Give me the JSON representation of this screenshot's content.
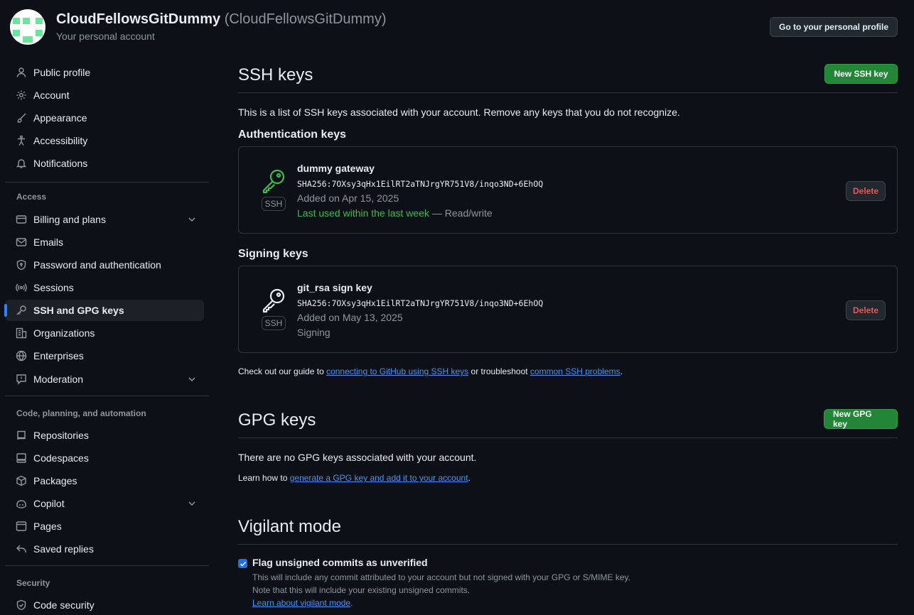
{
  "header": {
    "display_name": "CloudFellowsGitDummy",
    "login": "(CloudFellowsGitDummy)",
    "subtitle": "Your personal account",
    "profile_button": "Go to your personal profile"
  },
  "sidebar": {
    "group1": [
      {
        "label": "Public profile",
        "icon": "person-icon"
      },
      {
        "label": "Account",
        "icon": "gear-icon"
      },
      {
        "label": "Appearance",
        "icon": "paintbrush-icon"
      },
      {
        "label": "Accessibility",
        "icon": "accessibility-icon"
      },
      {
        "label": "Notifications",
        "icon": "bell-icon"
      }
    ],
    "access_heading": "Access",
    "access": [
      {
        "label": "Billing and plans",
        "icon": "credit-card-icon"
      },
      {
        "label": "Emails",
        "icon": "mail-icon"
      },
      {
        "label": "Password and authentication",
        "icon": "shield-lock-icon"
      },
      {
        "label": "Sessions",
        "icon": "broadcast-icon"
      },
      {
        "label": "SSH and GPG keys",
        "icon": "key-icon"
      },
      {
        "label": "Organizations",
        "icon": "organization-icon"
      },
      {
        "label": "Enterprises",
        "icon": "globe-icon"
      },
      {
        "label": "Moderation",
        "icon": "report-icon"
      }
    ],
    "code_heading": "Code, planning, and automation",
    "code": [
      {
        "label": "Repositories",
        "icon": "repo-icon"
      },
      {
        "label": "Codespaces",
        "icon": "codespaces-icon"
      },
      {
        "label": "Packages",
        "icon": "package-icon"
      },
      {
        "label": "Copilot",
        "icon": "copilot-icon"
      },
      {
        "label": "Pages",
        "icon": "browser-icon"
      },
      {
        "label": "Saved replies",
        "icon": "reply-icon"
      }
    ],
    "security_heading": "Security",
    "security": [
      {
        "label": "Code security",
        "icon": "shield-check-icon"
      }
    ]
  },
  "ssh": {
    "title": "SSH keys",
    "new_button": "New SSH key",
    "description": "This is a list of SSH keys associated with your account. Remove any keys that you do not recognize.",
    "auth_heading": "Authentication keys",
    "auth_key": {
      "name": "dummy gateway",
      "fingerprint": "SHA256:7OXsy3qHx1EilRT2aTNJrgYR751V8/inqo3ND+6EhOQ",
      "added": "Added on Apr 15, 2025",
      "last_used": "Last used within the last week",
      "access": " — Read/write",
      "badge": "SSH",
      "delete": "Delete",
      "icon_color": "#3fb950"
    },
    "signing_heading": "Signing keys",
    "signing_key": {
      "name": "git_rsa sign key",
      "fingerprint": "SHA256:7OXsy3qHx1EilRT2aTNJrgYR751V8/inqo3ND+6EhOQ",
      "added": "Added on May 13, 2025",
      "usage": "Signing",
      "badge": "SSH",
      "delete": "Delete"
    },
    "guide_prefix": "Check out our guide to ",
    "guide_link1": "connecting to GitHub using SSH keys",
    "guide_mid": " or troubleshoot ",
    "guide_link2": "common SSH problems",
    "guide_suffix": "."
  },
  "gpg": {
    "title": "GPG keys",
    "new_button": "New GPG key",
    "empty": "There are no GPG keys associated with your account.",
    "learn_prefix": "Learn how to ",
    "learn_link": "generate a GPG key and add it to your account",
    "learn_suffix": "."
  },
  "vigilant": {
    "title": "Vigilant mode",
    "checkbox_label": "Flag unsigned commits as unverified",
    "checked": true,
    "note1": "This will include any commit attributed to your account but not signed with your GPG or S/MIME key.",
    "note2": "Note that this will include your existing unsigned commits.",
    "link": "Learn about vigilant mode",
    "link_suffix": "."
  }
}
